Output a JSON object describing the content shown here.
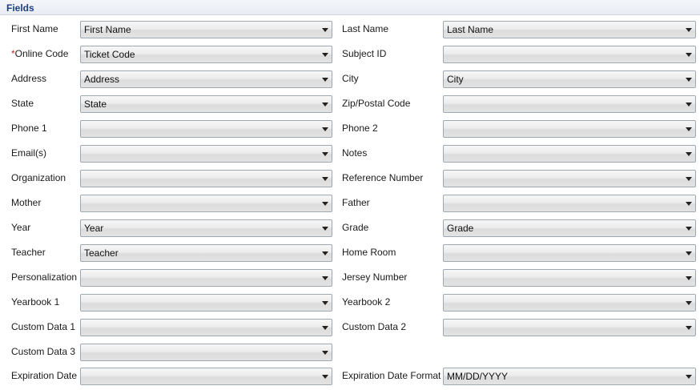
{
  "section_title": "Fields",
  "required_marker": "*",
  "left_fields": [
    {
      "label": "First Name",
      "value": "First Name"
    },
    {
      "label": "Online Code",
      "value": "Ticket Code",
      "required": true
    },
    {
      "label": "Address",
      "value": "Address"
    },
    {
      "label": "State",
      "value": "State"
    },
    {
      "label": "Phone 1",
      "value": ""
    },
    {
      "label": "Email(s)",
      "value": ""
    },
    {
      "label": "Organization",
      "value": ""
    },
    {
      "label": "Mother",
      "value": ""
    },
    {
      "label": "Year",
      "value": "Year"
    },
    {
      "label": "Teacher",
      "value": "Teacher"
    },
    {
      "label": "Personalization",
      "value": ""
    },
    {
      "label": "Yearbook 1",
      "value": ""
    },
    {
      "label": "Custom Data 1",
      "value": ""
    },
    {
      "label": "Custom Data 3",
      "value": ""
    },
    {
      "label": "Expiration Date",
      "value": ""
    }
  ],
  "right_fields": [
    {
      "label": "Last Name",
      "value": "Last Name"
    },
    {
      "label": "Subject ID",
      "value": ""
    },
    {
      "label": "City",
      "value": "City"
    },
    {
      "label": "Zip/Postal Code",
      "value": ""
    },
    {
      "label": "Phone 2",
      "value": ""
    },
    {
      "label": "Notes",
      "value": ""
    },
    {
      "label": "Reference Number",
      "value": ""
    },
    {
      "label": "Father",
      "value": ""
    },
    {
      "label": "Grade",
      "value": "Grade"
    },
    {
      "label": "Home Room",
      "value": ""
    },
    {
      "label": "Jersey Number",
      "value": ""
    },
    {
      "label": "Yearbook 2",
      "value": ""
    },
    {
      "label": "Custom Data 2",
      "value": ""
    },
    {
      "label": "Expiration Date Format",
      "value": "MM/DD/YYYY"
    }
  ]
}
